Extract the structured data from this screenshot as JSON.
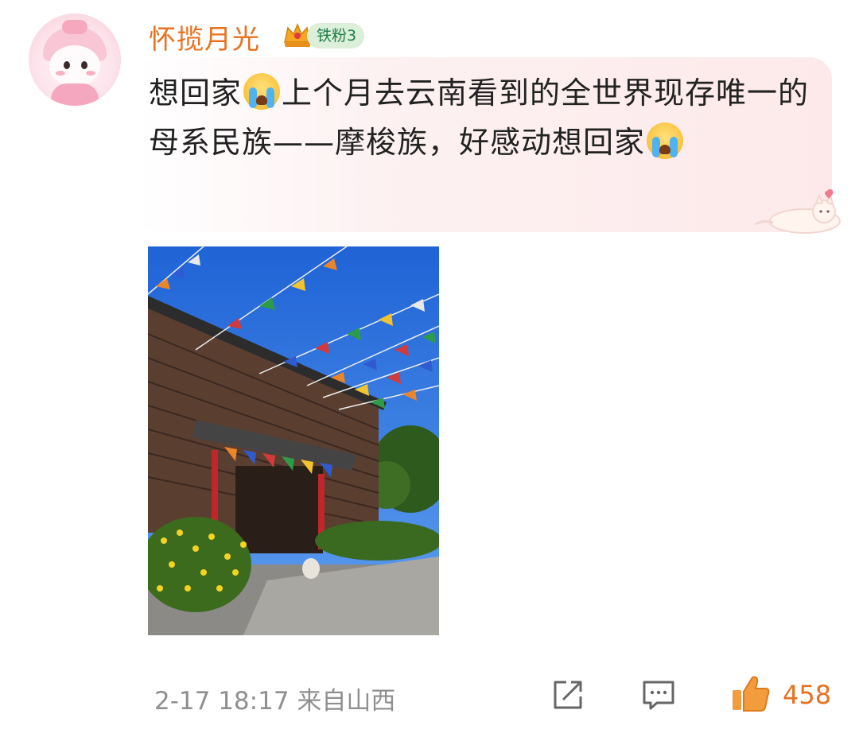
{
  "comment": {
    "username": "怀揽月光",
    "fan_badge": "铁粉3",
    "text_part1": "想回家",
    "text_part2": "上个月去云南看到的全世界现存唯一的母系民族——摩梭族，好感动想回家",
    "emoji": "crying-face",
    "timestamp": "2-17 18:17",
    "location": "来自山西",
    "like_count": "458"
  },
  "colors": {
    "username": "#e8711f",
    "badge_bg": "#dcefd9",
    "badge_text": "#1e7d4a",
    "meta": "#8f8f8f",
    "like": "#e8711f"
  },
  "icons": [
    "crown-icon",
    "share-icon",
    "comment-icon",
    "like-icon"
  ]
}
